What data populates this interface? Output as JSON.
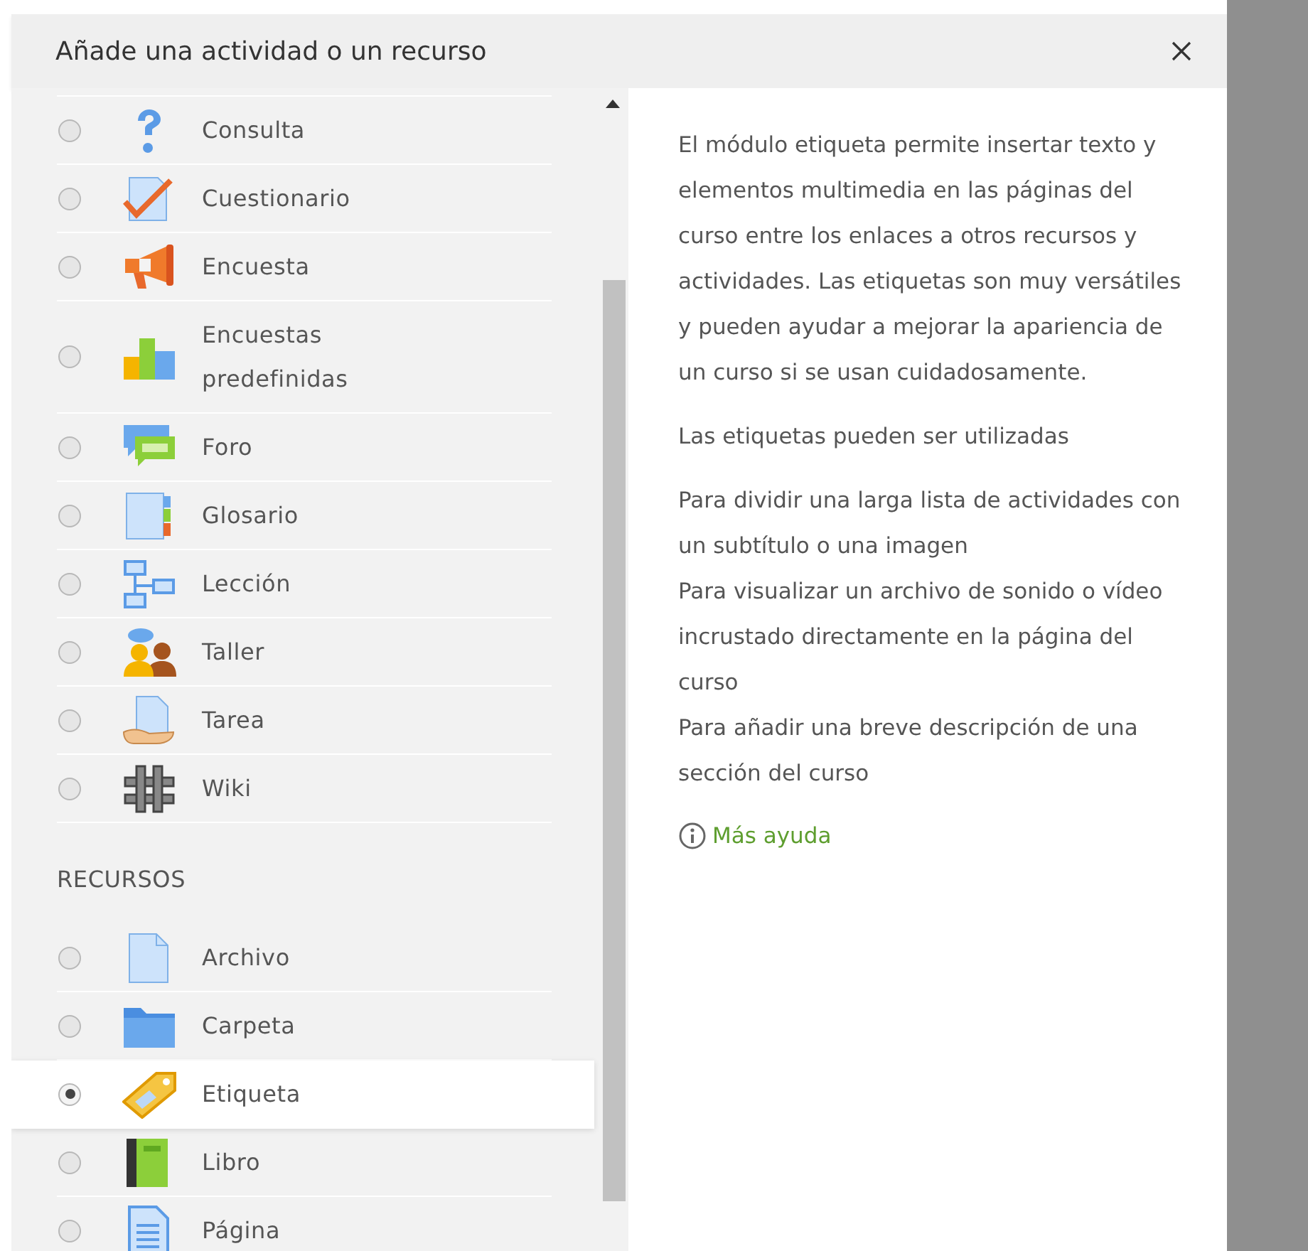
{
  "dialog": {
    "title": "Añade una actividad o un recurso"
  },
  "activities": [
    {
      "label": "Consulta",
      "kind": "question",
      "selected": false
    },
    {
      "label": "Cuestionario",
      "kind": "quiz",
      "selected": false
    },
    {
      "label": "Encuesta",
      "kind": "megaphone",
      "selected": false
    },
    {
      "label": "Encuestas predefinidas",
      "kind": "chart",
      "selected": false
    },
    {
      "label": "Foro",
      "kind": "forum",
      "selected": false
    },
    {
      "label": "Glosario",
      "kind": "glossary",
      "selected": false
    },
    {
      "label": "Lección",
      "kind": "lesson",
      "selected": false
    },
    {
      "label": "Taller",
      "kind": "people",
      "selected": false
    },
    {
      "label": "Tarea",
      "kind": "assignment",
      "selected": false
    },
    {
      "label": "Wiki",
      "kind": "wiki",
      "selected": false
    }
  ],
  "resources_heading": "RECURSOS",
  "resources": [
    {
      "label": "Archivo",
      "kind": "file",
      "selected": false
    },
    {
      "label": "Carpeta",
      "kind": "folder",
      "selected": false
    },
    {
      "label": "Etiqueta",
      "kind": "tag",
      "selected": true
    },
    {
      "label": "Libro",
      "kind": "book",
      "selected": false
    },
    {
      "label": "Página",
      "kind": "page",
      "selected": false
    }
  ],
  "description": {
    "paragraphs": [
      "El módulo etiqueta permite insertar texto y elementos multimedia en las páginas del curso entre los enlaces a otros recursos y actividades. Las etiquetas son muy versátiles y pueden ayudar a mejorar la apariencia de un curso si se usan cuidadosamente.",
      "Las etiquetas pueden ser utilizadas"
    ],
    "uses": [
      "Para dividir una larga lista de actividades con un subtítulo o una imagen",
      "Para visualizar un archivo de sonido o vídeo incrustado directamente en la página del curso",
      "Para añadir una breve descripción de una sección del curso"
    ],
    "help_link": "Más ayuda"
  }
}
